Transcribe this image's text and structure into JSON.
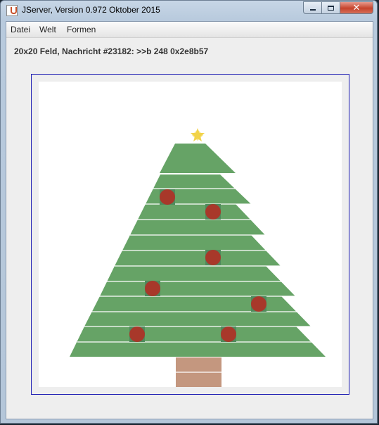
{
  "window": {
    "title": "JServer, Version 0.972 Oktober 2015",
    "controls": [
      "minimize",
      "maximize",
      "close"
    ]
  },
  "menu": {
    "items": [
      {
        "label": "Datei"
      },
      {
        "label": "Welt"
      },
      {
        "label": "Formen"
      }
    ]
  },
  "status": {
    "text": "20x20 Feld, Nachricht #23182: >>b 248 0x2e8b57"
  },
  "board": {
    "grid": "20x20",
    "colors": {
      "tree": "#66a366",
      "ornament": "#a8382a",
      "trunk": "#c4977f",
      "star": "#f2d34a",
      "border": "#1d1db3"
    },
    "icons": [
      "star-icon",
      "ornament-icon"
    ]
  }
}
